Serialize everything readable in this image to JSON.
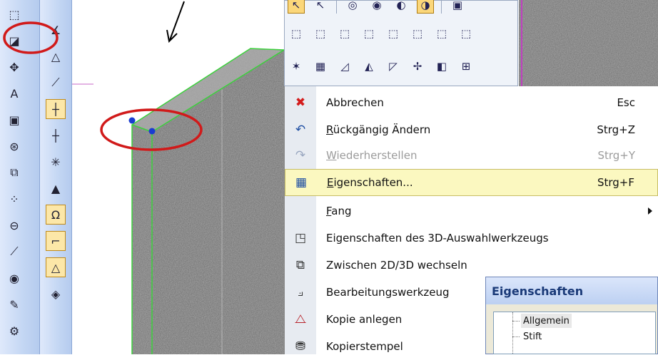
{
  "left_toolbar_a": {
    "buttons": [
      {
        "name": "box-3d-icon",
        "glyph": "⬚"
      },
      {
        "name": "wall-tool-icon",
        "glyph": "◪"
      },
      {
        "name": "move-icon",
        "glyph": "✥"
      },
      {
        "name": "text-icon",
        "glyph": "A"
      },
      {
        "name": "fill-color-icon",
        "glyph": "▣"
      },
      {
        "name": "snap-circle-icon",
        "glyph": "⊛"
      },
      {
        "name": "layer-icon",
        "glyph": "⧉"
      },
      {
        "name": "points-icon",
        "glyph": "⁘"
      },
      {
        "name": "lock-icon",
        "glyph": "⊖"
      },
      {
        "name": "knife-icon",
        "glyph": "⟋"
      },
      {
        "name": "view-icon",
        "glyph": "◉"
      },
      {
        "name": "paint-icon",
        "glyph": "✎"
      },
      {
        "name": "settings-icon",
        "glyph": "⚙"
      }
    ]
  },
  "left_toolbar_b": {
    "buttons": [
      {
        "name": "angle-icon",
        "glyph": "∡"
      },
      {
        "name": "shape-icon",
        "glyph": "△"
      },
      {
        "name": "line-icon",
        "glyph": "⟋"
      },
      {
        "name": "point-snap-icon",
        "glyph": "┼"
      },
      {
        "name": "cross-snap-icon",
        "glyph": "┼"
      },
      {
        "name": "star-snap-icon",
        "glyph": "✳"
      },
      {
        "name": "triangle-fill-icon",
        "glyph": "▲"
      },
      {
        "name": "magnet-icon",
        "glyph": "Ω"
      },
      {
        "name": "corner-snap-icon",
        "glyph": "⌐"
      },
      {
        "name": "triangle-snap-icon",
        "glyph": "△"
      },
      {
        "name": "object-icon",
        "glyph": "◈"
      }
    ]
  },
  "palette": {
    "row1": [
      {
        "name": "cursor-select-icon",
        "glyph": "↖",
        "selected": true
      },
      {
        "name": "cursor-icon",
        "glyph": "↖",
        "selected": false
      },
      {
        "name": "orbit-icon",
        "glyph": "◎",
        "selected": false
      },
      {
        "name": "zoom-icon",
        "glyph": "◉",
        "selected": false
      },
      {
        "name": "render-icon",
        "glyph": "◐",
        "selected": false
      },
      {
        "name": "shaded-icon",
        "glyph": "◑",
        "selected": true
      },
      {
        "name": "camera-icon",
        "glyph": "▣",
        "selected": false
      }
    ],
    "row2": [
      {
        "name": "view-front-icon",
        "glyph": "⬚"
      },
      {
        "name": "view-iso-1-icon",
        "glyph": "⬚"
      },
      {
        "name": "view-iso-2-icon",
        "glyph": "⬚"
      },
      {
        "name": "view-iso-3-icon",
        "glyph": "⬚"
      },
      {
        "name": "view-iso-4-icon",
        "glyph": "⬚"
      },
      {
        "name": "view-iso-5-icon",
        "glyph": "⬚"
      },
      {
        "name": "view-iso-6-icon",
        "glyph": "⬚"
      },
      {
        "name": "view-iso-7-icon",
        "glyph": "⬚"
      }
    ],
    "row3": [
      {
        "name": "plane-axis-icon",
        "glyph": "✶"
      },
      {
        "name": "grid-icon",
        "glyph": "▦"
      },
      {
        "name": "plane-xy-icon",
        "glyph": "◿"
      },
      {
        "name": "plane-yz-icon",
        "glyph": "◭"
      },
      {
        "name": "plane-xz-icon",
        "glyph": "◸"
      },
      {
        "name": "plane-move-icon",
        "glyph": "✢"
      },
      {
        "name": "section-icon",
        "glyph": "◧"
      },
      {
        "name": "fit-icon",
        "glyph": "⊞"
      }
    ]
  },
  "context_menu": {
    "items": [
      {
        "name": "menu-item-abbrechen",
        "icon": "close-icon",
        "glyph": "✖",
        "icon_color": "#d41c1c",
        "label": "Abbrechen",
        "shortcut": "Esc",
        "disabled": false,
        "highlight": false,
        "submenu": false
      },
      {
        "name": "menu-item-rueckgaengig",
        "icon": "undo-icon",
        "glyph": "↶",
        "icon_color": "#1f4fa3",
        "label": "Rückgängig Ändern",
        "shortcut": "Strg+Z",
        "disabled": false,
        "highlight": false,
        "submenu": false
      },
      {
        "name": "menu-item-wiederherstellen",
        "icon": "redo-icon",
        "glyph": "↷",
        "icon_color": "#9aa7c0",
        "label": "Wiederherstellen",
        "shortcut": "Strg+Y",
        "disabled": true,
        "highlight": false,
        "submenu": false
      },
      {
        "name": "menu-item-eigenschaften",
        "icon": "properties-icon",
        "glyph": "▦",
        "icon_color": "#1f4fa3",
        "label": "Eigenschaften...",
        "shortcut": "Strg+F",
        "disabled": false,
        "highlight": true,
        "submenu": false
      },
      {
        "name": "menu-item-fang",
        "icon": "",
        "glyph": "",
        "icon_color": "#000000",
        "label": "Fang",
        "shortcut": "",
        "disabled": false,
        "highlight": false,
        "submenu": true
      },
      {
        "name": "menu-item-eigenschaften-3d",
        "icon": "select-3d-icon",
        "glyph": "◳",
        "icon_color": "#333333",
        "label": "Eigenschaften des 3D-Auswahlwerkzeugs",
        "shortcut": "",
        "disabled": false,
        "highlight": false,
        "submenu": false
      },
      {
        "name": "menu-item-wechseln",
        "icon": "switch-2d3d-icon",
        "glyph": "⧉",
        "icon_color": "#333333",
        "label": "Zwischen 2D/3D wechseln",
        "shortcut": "",
        "disabled": false,
        "highlight": false,
        "submenu": false
      },
      {
        "name": "menu-item-bearbeitung",
        "icon": "edit-tool-icon",
        "glyph": "⟓",
        "icon_color": "#333333",
        "label": "Bearbeitungswerkzeug",
        "shortcut": "",
        "disabled": false,
        "highlight": false,
        "submenu": false
      },
      {
        "name": "menu-item-kopie",
        "icon": "copy-icon",
        "glyph": "⧍",
        "icon_color": "#b8222a",
        "label": "Kopie anlegen",
        "shortcut": "",
        "disabled": false,
        "highlight": false,
        "submenu": false
      },
      {
        "name": "menu-item-kopierstempel",
        "icon": "stamp-icon",
        "glyph": "⛃",
        "icon_color": "#333333",
        "label": "Kopierstempel",
        "shortcut": "",
        "disabled": false,
        "highlight": false,
        "submenu": false
      }
    ]
  },
  "properties_dialog": {
    "title": "Eigenschaften",
    "tree": [
      {
        "label": "Allgemein",
        "selected": true
      },
      {
        "label": "Stift",
        "selected": false
      }
    ]
  },
  "colors": {
    "annotation_red": "#d11a1a",
    "wall_edge_green": "#3cd23c",
    "handle_blue": "#1a3cd1",
    "highlight_yellow": "#fbf8c0"
  }
}
